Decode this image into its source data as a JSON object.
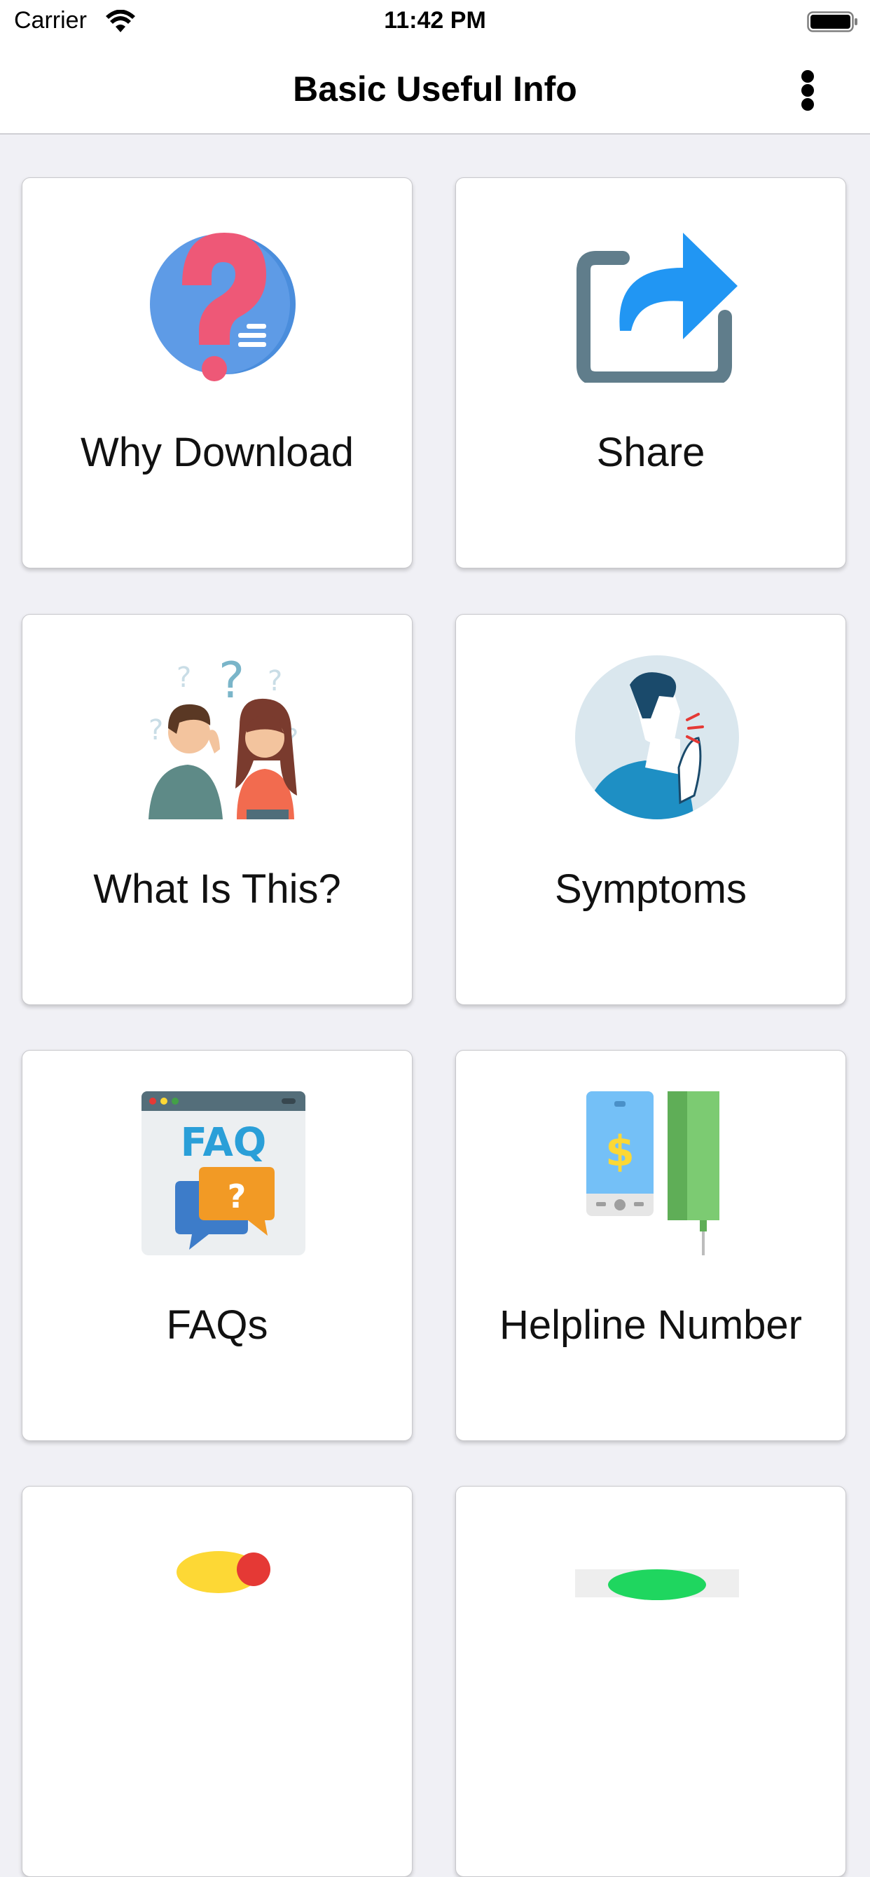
{
  "status": {
    "carrier": "Carrier",
    "time": "11:42 PM"
  },
  "nav": {
    "title": "Basic Useful Info"
  },
  "cards": [
    {
      "label": "Why Download",
      "icon": "question-mark-icon"
    },
    {
      "label": "Share",
      "icon": "share-icon"
    },
    {
      "label": "What Is This?",
      "icon": "confused-people-icon"
    },
    {
      "label": "Symptoms",
      "icon": "coughing-person-icon"
    },
    {
      "label": "FAQs",
      "icon": "faq-icon"
    },
    {
      "label": "Helpline Number",
      "icon": "phone-icon"
    }
  ],
  "colors": {
    "background": "#f0f0f5",
    "share_blue": "#2196f3",
    "question_pink": "#ee5877"
  }
}
